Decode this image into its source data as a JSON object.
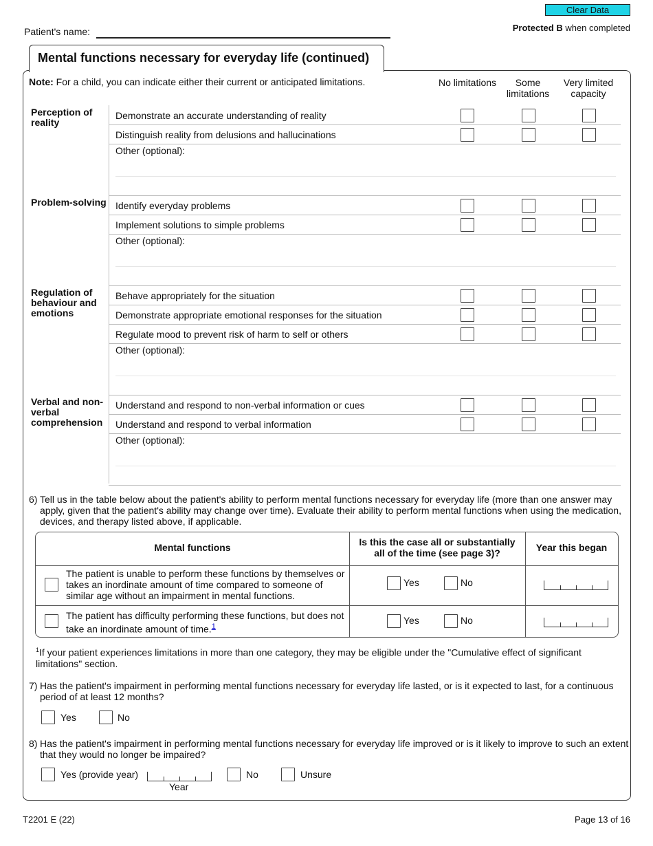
{
  "header": {
    "clear_button": "Clear Data",
    "patient_name_label": "Patient's name:",
    "protected_bold": "Protected B",
    "protected_rest": " when completed"
  },
  "section": {
    "title": "Mental functions necessary for everyday life (continued)",
    "note_bold": "Note:",
    "note_text": " For a child, you can indicate either their current or anticipated limitations.",
    "columns": [
      "No limitations",
      "Some limitations",
      "Very limited capacity"
    ],
    "groups": [
      {
        "label": "Perception of reality",
        "items": [
          "Demonstrate an accurate understanding of reality",
          "Distinguish reality from delusions and hallucinations"
        ],
        "other": "Other (optional):"
      },
      {
        "label": "Problem-solving",
        "items": [
          "Identify everyday problems",
          "Implement solutions to simple problems"
        ],
        "other": "Other (optional):"
      },
      {
        "label": "Regulation of behaviour and emotions",
        "items": [
          "Behave appropriately for the situation",
          "Demonstrate appropriate emotional responses for the situation",
          "Regulate mood to prevent risk of harm to self or others"
        ],
        "other": "Other (optional):"
      },
      {
        "label": "Verbal and non-verbal comprehension",
        "items": [
          "Understand and respond to non-verbal information or cues",
          "Understand and respond to verbal information"
        ],
        "other": "Other (optional):"
      }
    ]
  },
  "q6": {
    "number": "6)",
    "text": "Tell us in the table below about the patient's ability to perform mental functions necessary for everyday life (more than one answer may apply, given that the patient's ability may change over time). Evaluate their ability to perform mental functions when using the medication, devices, and therapy listed above, if applicable.",
    "table": {
      "headers": [
        "Mental functions",
        "Is this the case all or substantially all of the time (see page 3)?",
        "Year this began"
      ],
      "rows": [
        {
          "text": "The patient is unable to perform these functions by themselves or takes an inordinate amount of time compared to someone of similar age without an impairment in mental functions.",
          "footnote": ""
        },
        {
          "text": "The patient has difficulty performing these functions, but does not take an inordinate amount of time.",
          "footnote": "1"
        }
      ],
      "yes": "Yes",
      "no": "No"
    }
  },
  "footnote": {
    "mark": "1",
    "text": "If your patient experiences limitations in more than one category, they may be eligible under the \"Cumulative effect of significant limitations\" section."
  },
  "q7": {
    "number": "7)",
    "text": "Has the patient's impairment in performing mental functions necessary for everyday life lasted, or is it expected to last, for a continuous period of at least 12 months?",
    "yes": "Yes",
    "no": "No"
  },
  "q8": {
    "number": "8)",
    "text": "Has the patient's impairment in performing mental functions necessary for everyday life improved or is it likely to improve to such an extent that they would no longer be impaired?",
    "yes": "Yes (provide year)",
    "year_label": "Year",
    "no": "No",
    "unsure": "Unsure"
  },
  "footer": {
    "form_id": "T2201 E (22)",
    "page": "Page 13 of 16"
  },
  "colors": {
    "clear_button": "#1fd3e6",
    "link": "#0000cc"
  }
}
